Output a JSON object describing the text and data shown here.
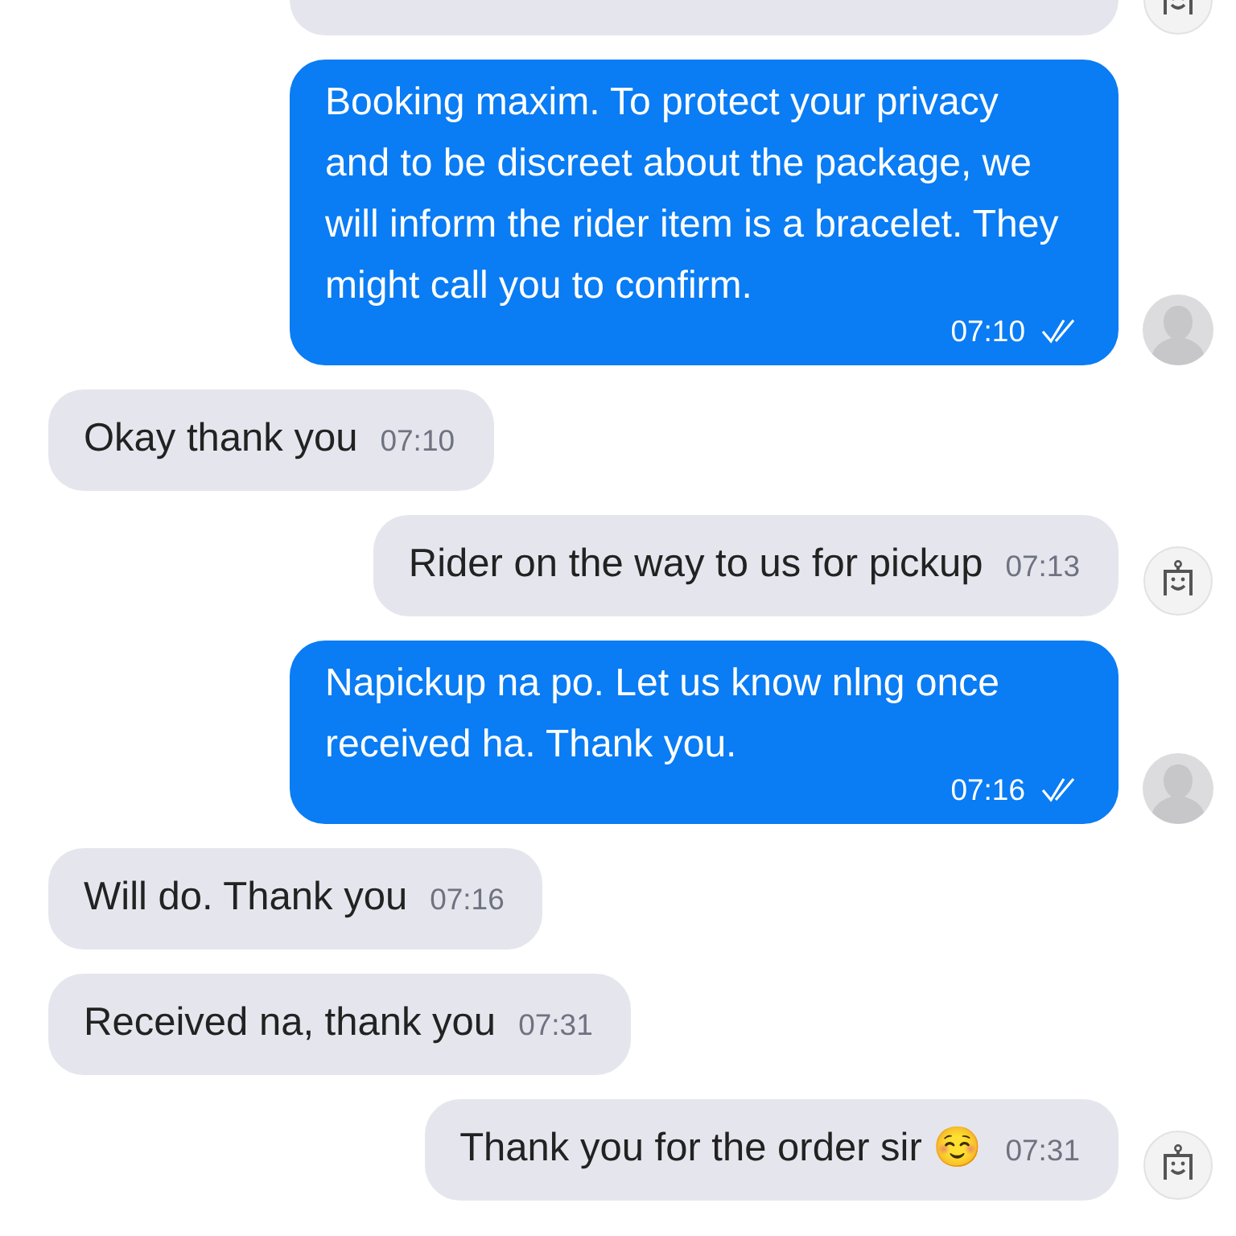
{
  "messages": [
    {
      "kind": "bot",
      "partial": true
    },
    {
      "kind": "agent",
      "text": "Booking maxim. To protect your privacy and to be discreet about the package, we will inform the rider item is a bracelet. They might call you to confirm.",
      "time": "07:10",
      "read": true
    },
    {
      "kind": "customer",
      "text": "Okay thank you",
      "time": "07:10"
    },
    {
      "kind": "bot",
      "text": "Rider on the way to us for pickup",
      "time": "07:13"
    },
    {
      "kind": "agent",
      "text": "Napickup na po. Let us know nlng once received ha. Thank you.",
      "time": "07:16",
      "read": true
    },
    {
      "kind": "customer",
      "text": "Will do. Thank you",
      "time": "07:16"
    },
    {
      "kind": "customer",
      "text": "Received na, thank you",
      "time": "07:31"
    },
    {
      "kind": "bot",
      "text": "Thank you for the order sir ☺️",
      "time": "07:31"
    }
  ]
}
